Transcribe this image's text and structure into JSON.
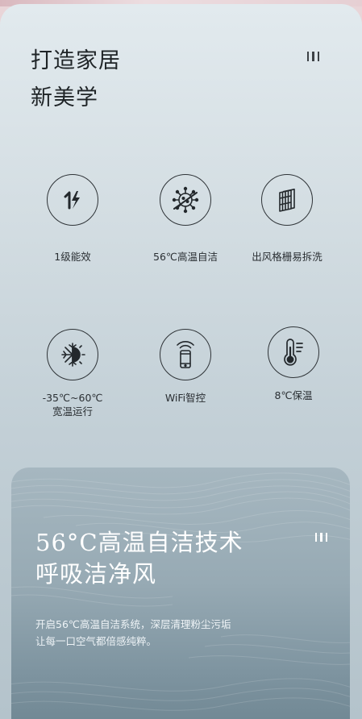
{
  "header": {
    "title_line1": "打造家居",
    "title_line2": "新美学",
    "menu_icon": "three-bars-icon"
  },
  "features": [
    {
      "label": "1级能效",
      "icon": "energy-rating-icon"
    },
    {
      "label": "56℃高温自洁",
      "icon": "virus-clean-icon"
    },
    {
      "label": "出风格栅易拆洗",
      "icon": "grille-icon"
    },
    {
      "label": "-35℃~60℃\n宽温运行",
      "icon": "snow-sun-icon"
    },
    {
      "label": "WiFi智控",
      "icon": "wifi-phone-icon"
    },
    {
      "label": "8℃保温",
      "icon": "thermometer-icon"
    }
  ],
  "panel": {
    "title_line1": "56°C高温自洁技术",
    "title_line2": "呼吸洁净风",
    "desc_line1": "开启56℃高温自洁系统，深层清理粉尘污垢",
    "desc_line2": "让每一口空气都倍感纯粹。",
    "menu_icon": "three-bars-icon"
  },
  "colors": {
    "background_top": "#e2eaee",
    "background_bottom": "#b4c3cb",
    "panel": "#97aab4",
    "text_dark": "#1f2427"
  }
}
